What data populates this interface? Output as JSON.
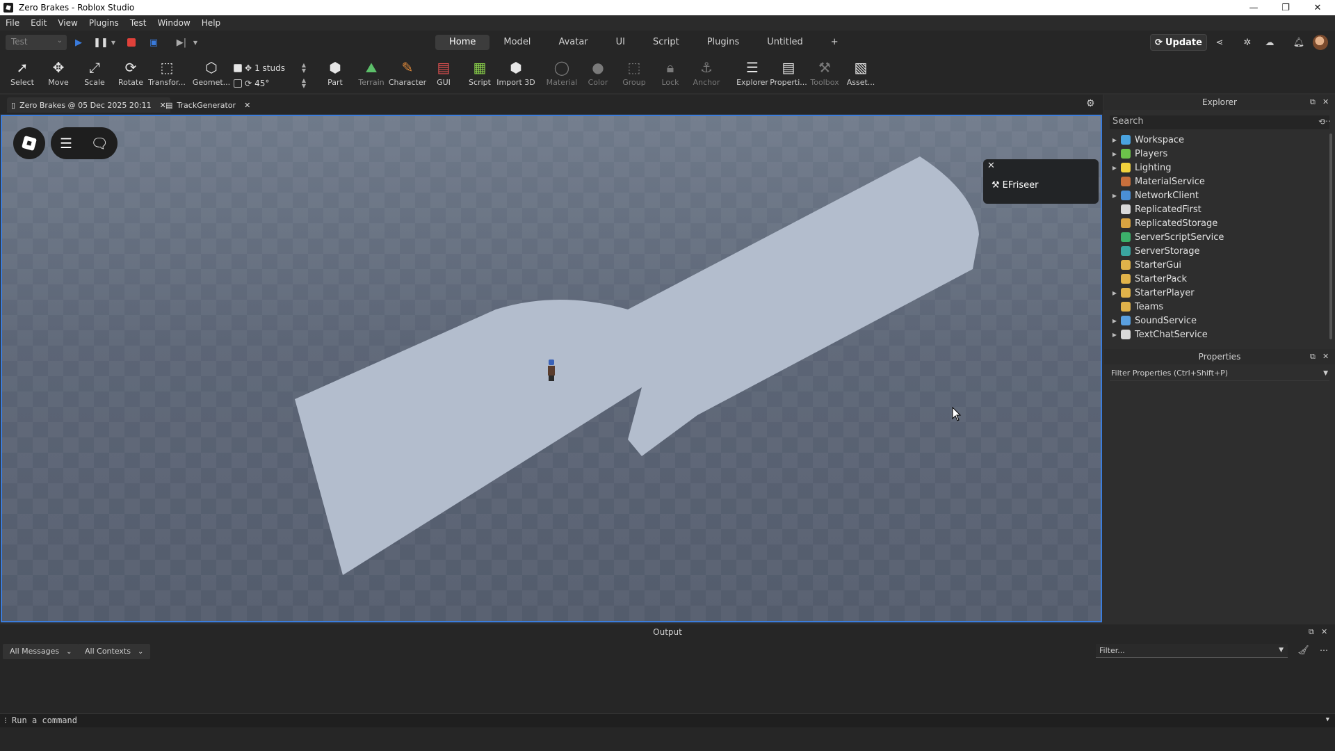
{
  "window": {
    "title": "Zero Brakes - Roblox Studio"
  },
  "menu": [
    "File",
    "Edit",
    "View",
    "Plugins",
    "Test",
    "Window",
    "Help"
  ],
  "top": {
    "mode_select": "Test",
    "tabs": [
      "Home",
      "Model",
      "Avatar",
      "UI",
      "Script",
      "Plugins",
      "Untitled"
    ],
    "add_tab": "+",
    "update_label": "Update"
  },
  "toolbar": {
    "select": "Select",
    "move": "Move",
    "scale": "Scale",
    "rotate": "Rotate",
    "transform": "Transfor...",
    "geometry": "Geomet...",
    "move_snap": "1 studs",
    "rotate_snap": "45°",
    "part": "Part",
    "terrain": "Terrain",
    "character": "Character",
    "gui": "GUI",
    "script": "Script",
    "import3d": "Import 3D",
    "material": "Material",
    "color": "Color",
    "group": "Group",
    "lock": "Lock",
    "anchor": "Anchor",
    "explorer": "Explorer",
    "properties": "Properti...",
    "toolbox": "Toolbox",
    "assets": "Asset..."
  },
  "doc_tabs": [
    {
      "label": "Zero Brakes @ 05 Dec 2025 20:11"
    },
    {
      "label": "TrackGenerator"
    }
  ],
  "notification": {
    "text": "EFriseer"
  },
  "explorer": {
    "title": "Explorer",
    "search_placeholder": "Search",
    "items": [
      {
        "label": "Workspace",
        "expandable": true,
        "color": "#4aa3df"
      },
      {
        "label": "Players",
        "expandable": true,
        "color": "#6cc24a"
      },
      {
        "label": "Lighting",
        "expandable": true,
        "color": "#f2d23c"
      },
      {
        "label": "MaterialService",
        "expandable": false,
        "color": "#c86f3c"
      },
      {
        "label": "NetworkClient",
        "expandable": true,
        "color": "#4a8fd6"
      },
      {
        "label": "ReplicatedFirst",
        "expandable": false,
        "color": "#d9d9d9"
      },
      {
        "label": "ReplicatedStorage",
        "expandable": false,
        "color": "#d9a441"
      },
      {
        "label": "ServerScriptService",
        "expandable": false,
        "color": "#3cb06a"
      },
      {
        "label": "ServerStorage",
        "expandable": false,
        "color": "#3aa5a0"
      },
      {
        "label": "StarterGui",
        "expandable": false,
        "color": "#e0b24a"
      },
      {
        "label": "StarterPack",
        "expandable": false,
        "color": "#e0b24a"
      },
      {
        "label": "StarterPlayer",
        "expandable": true,
        "color": "#e0b24a"
      },
      {
        "label": "Teams",
        "expandable": false,
        "color": "#e0b24a"
      },
      {
        "label": "SoundService",
        "expandable": true,
        "color": "#5aa0e0"
      },
      {
        "label": "TextChatService",
        "expandable": true,
        "color": "#d9d9d9"
      }
    ]
  },
  "properties": {
    "title": "Properties",
    "filter_placeholder": "Filter Properties (Ctrl+Shift+P)"
  },
  "output": {
    "title": "Output",
    "messages_filter": "All Messages",
    "contexts_filter": "All Contexts",
    "filter_placeholder": "Filter..."
  },
  "command": {
    "placeholder": "Run a command"
  },
  "colors": {
    "accent": "#3b7ddd",
    "stop": "#e0413a",
    "play": "#3a7bdc",
    "track": "#b3bdcd"
  }
}
